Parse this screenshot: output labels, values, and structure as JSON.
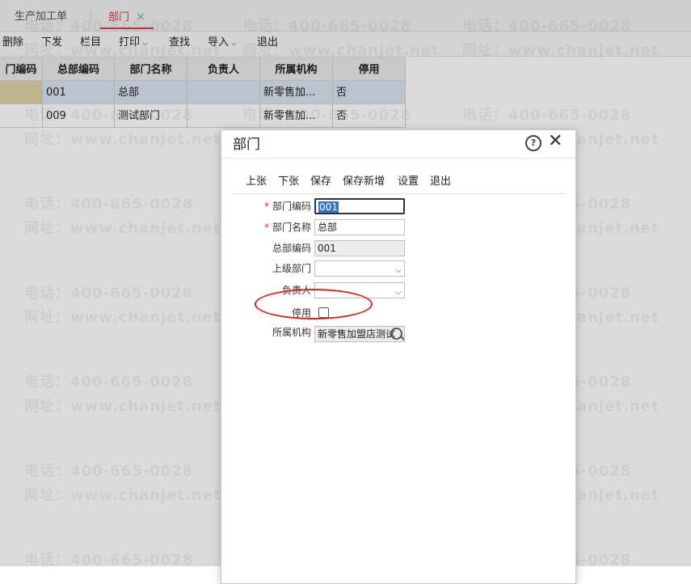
{
  "tabs": [
    {
      "label": "生产加工单"
    },
    {
      "label": "部门",
      "close": "×"
    }
  ],
  "toolbar": {
    "items": [
      "删除",
      "下发",
      "栏目",
      "打印",
      "查找",
      "导入",
      "退出"
    ]
  },
  "grid": {
    "headers": [
      "门编码",
      "总部编码",
      "部门名称",
      "负责人",
      "所属机构",
      "停用"
    ],
    "rows": [
      [
        "",
        "001",
        "总部",
        "",
        "新零售加...",
        "否"
      ],
      [
        "",
        "009",
        "测试部门",
        "",
        "新零售加...",
        "否"
      ]
    ]
  },
  "watermark": {
    "phone": "电话：400-665-0028",
    "site": "网址：www.chanjet.net"
  },
  "dialog": {
    "title": "部门",
    "help": "?",
    "close": "✕",
    "toolbar": [
      "上张",
      "下张",
      "保存",
      "保存新增",
      "设置",
      "退出"
    ],
    "fields": {
      "dept_code": {
        "label": "部门编码",
        "value": "001",
        "required": "*"
      },
      "dept_name": {
        "label": "部门名称",
        "value": "总部",
        "required": "*"
      },
      "hq_code": {
        "label": "总部编码",
        "value": "001"
      },
      "parent_dept": {
        "label": "上级部门",
        "value": ""
      },
      "manager": {
        "label": "负责人",
        "value": ""
      },
      "disabled": {
        "label": "停用",
        "checked": false
      },
      "org": {
        "label": "所属机构",
        "value": "新零售加盟店测试"
      }
    }
  },
  "colors": {
    "accent": "#d9363e",
    "annotation": "#e01e1e",
    "selected_row": "#d9e3f0"
  }
}
